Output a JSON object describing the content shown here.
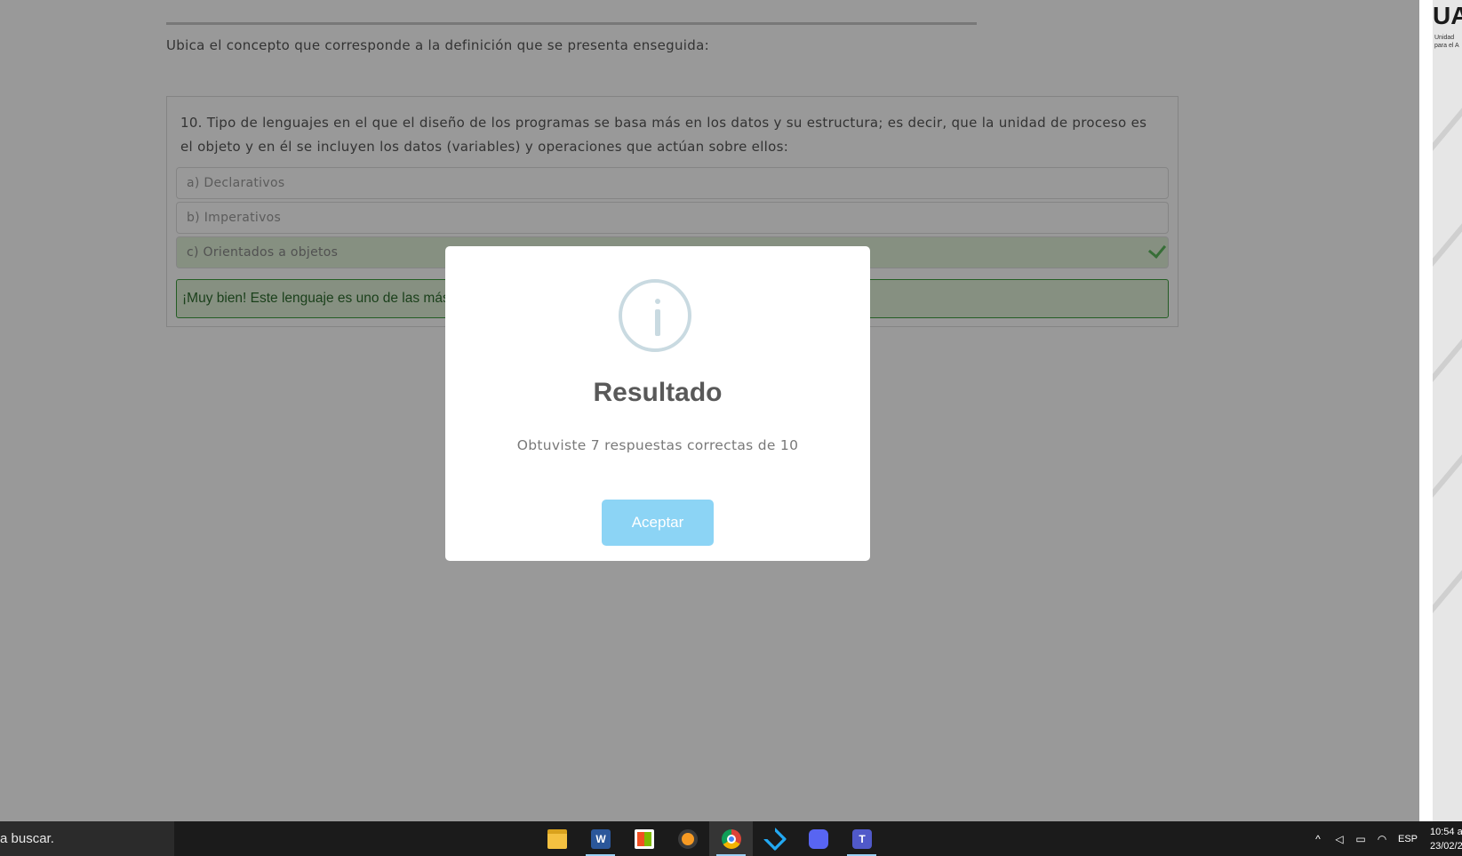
{
  "instruction": "Ubica el concepto que corresponde a la definición que se presenta enseguida:",
  "question": {
    "text": "10. Tipo de lenguajes en el que el diseño de los programas se basa más en los datos y su estructura; es decir, que la unidad de proceso es el objeto y en él se incluyen los datos (variables) y operaciones que actúan sobre ellos:",
    "options": [
      "a) Declarativos",
      "b) Imperativos",
      "c) Orientados a objetos"
    ],
    "correct_option": "c) Orientados a objetos",
    "feedback": "¡Muy bien! Este lenguaje es uno de las más"
  },
  "side_logo": {
    "text": "UA",
    "subtitle_line1": "Unidad",
    "subtitle_line2": "para el A"
  },
  "modal": {
    "icon": "info-icon",
    "title": "Resultado",
    "message": "Obtuviste 7 respuestas correctas de 10",
    "button_label": "Aceptar",
    "button_color": "#8cd4f5"
  },
  "taskbar": {
    "search_text": "a buscar.",
    "apps": [
      {
        "name": "file-explorer-icon"
      },
      {
        "name": "word-icon",
        "glyph": "W"
      },
      {
        "name": "store-icon"
      },
      {
        "name": "fl-studio-icon"
      },
      {
        "name": "chrome-icon"
      },
      {
        "name": "vscode-icon"
      },
      {
        "name": "discord-icon"
      },
      {
        "name": "teams-icon",
        "glyph": "T"
      }
    ],
    "tray": {
      "language": "ESP",
      "time": "10:54 a",
      "date": "23/02/2"
    }
  },
  "colors": {
    "correct_bg": "#dff0d8",
    "correct_border": "#3c9c3c",
    "overlay": "rgba(0,0,0,0.4)"
  }
}
